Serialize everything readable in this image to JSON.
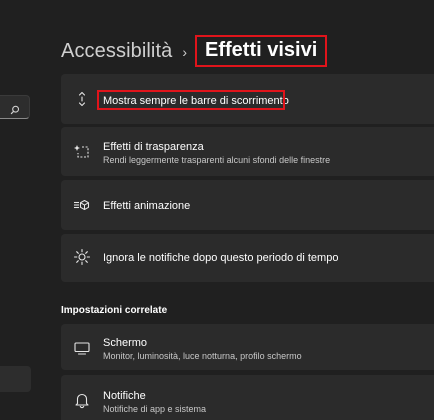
{
  "breadcrumb": {
    "parent": "Accessibilità",
    "separator": "›",
    "current": "Effetti visivi"
  },
  "sidebar": {
    "search_icon": "search-icon"
  },
  "settings": [
    {
      "title": "Mostra sempre le barre di scorrimento",
      "subtitle": "",
      "icon": "scrollbar-icon"
    },
    {
      "title": "Effetti di trasparenza",
      "subtitle": "Rendi leggermente trasparenti alcuni sfondi delle finestre",
      "icon": "transparency-icon"
    },
    {
      "title": "Effetti animazione",
      "subtitle": "",
      "icon": "animation-icon"
    },
    {
      "title": "Ignora le notifiche dopo questo periodo di tempo",
      "subtitle": "",
      "icon": "notification-timer-icon"
    }
  ],
  "related": {
    "heading": "Impostazioni correlate",
    "items": [
      {
        "title": "Schermo",
        "subtitle": "Monitor, luminosità, luce notturna, profilo schermo",
        "icon": "monitor-icon"
      },
      {
        "title": "Notifiche",
        "subtitle": "Notifiche di app e sistema",
        "icon": "bell-icon"
      }
    ]
  },
  "colors": {
    "background": "#202020",
    "card": "#2b2b2b",
    "highlight": "#e0141b"
  }
}
